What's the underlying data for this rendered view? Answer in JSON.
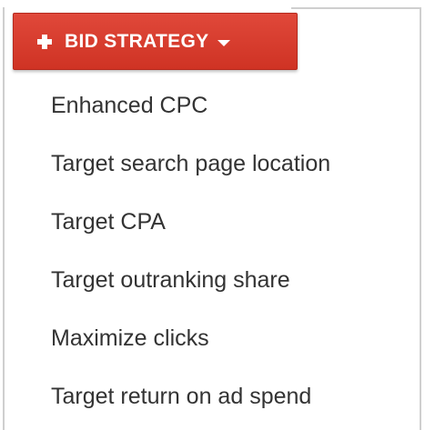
{
  "button": {
    "label": "BID STRATEGY",
    "icon_left": "plus-icon",
    "icon_right": "caret-down-icon",
    "color": "#d63b2d"
  },
  "menu": {
    "items": [
      {
        "label": "Enhanced CPC"
      },
      {
        "label": "Target search page location"
      },
      {
        "label": "Target CPA"
      },
      {
        "label": "Target outranking share"
      },
      {
        "label": "Maximize clicks"
      },
      {
        "label": "Target return on ad spend"
      }
    ]
  }
}
